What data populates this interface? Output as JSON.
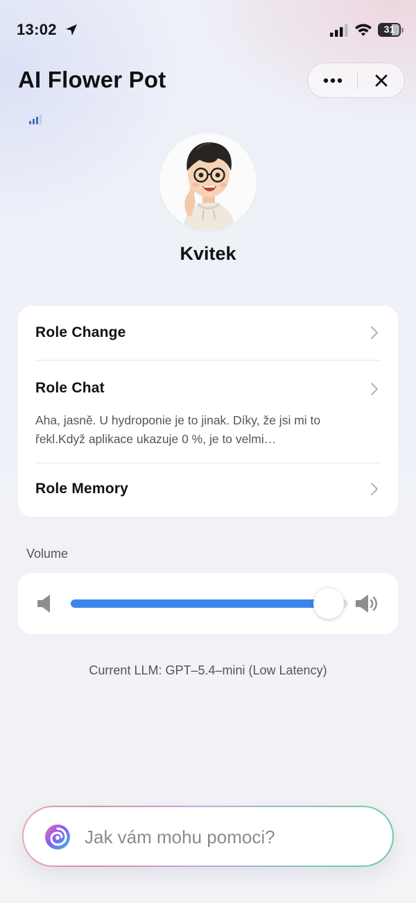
{
  "status_bar": {
    "time": "13:02",
    "battery_level": "31"
  },
  "header": {
    "title": "AI Flower Pot",
    "more_icon": "more-dots-icon",
    "close_icon": "close-icon"
  },
  "profile": {
    "name": "Kvitek",
    "avatar_icon": "cartoon-boy-avatar"
  },
  "menu": {
    "items": [
      {
        "label": "Role Change"
      },
      {
        "label": "Role Chat",
        "description": "Aha, jasně. U hydroponie je to jinak. Díky, že jsi mi to řekl.Když aplikace ukazuje 0 %, je to velmi…"
      },
      {
        "label": "Role Memory"
      }
    ]
  },
  "volume": {
    "label": "Volume",
    "level": 0.93
  },
  "llm_info": "Current LLM: GPT–5.4–mini (Low Latency)",
  "input": {
    "placeholder": "Jak vám mohu pomoci?"
  },
  "colors": {
    "accent": "#3c86e9",
    "text": "#111111",
    "muted": "#555555"
  }
}
